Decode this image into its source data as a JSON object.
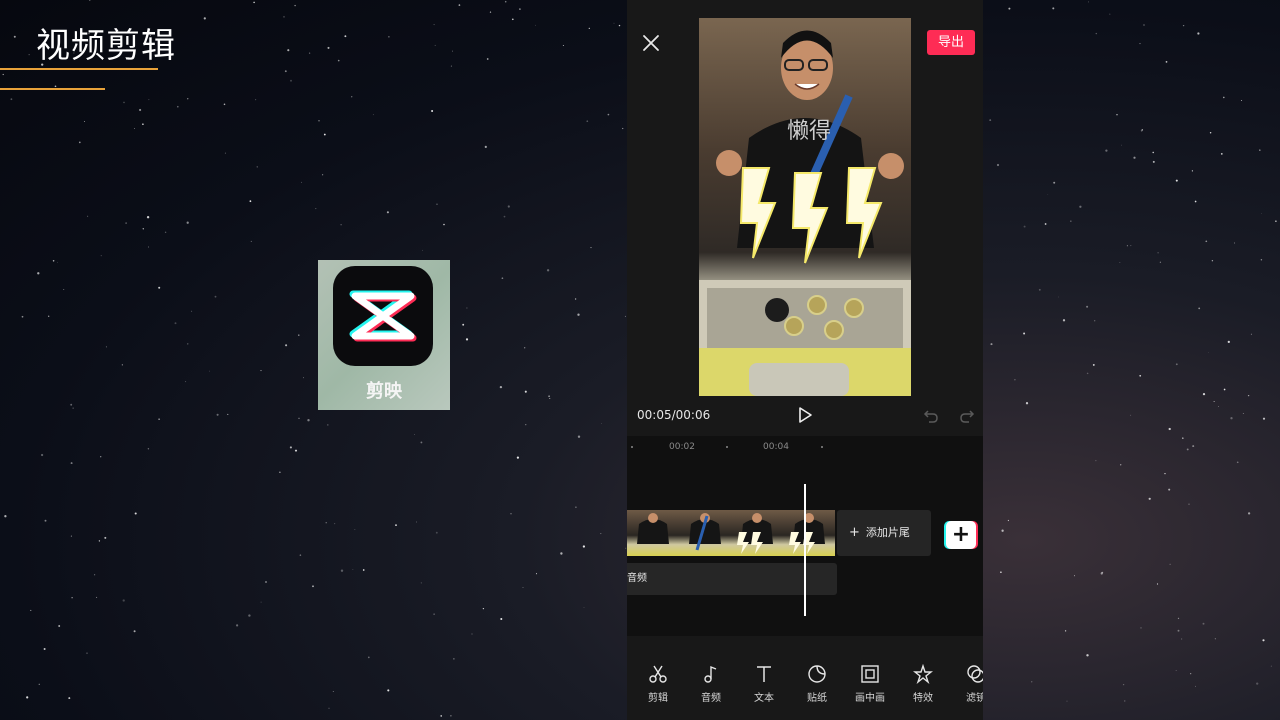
{
  "slide": {
    "title": "视频剪辑"
  },
  "app_icon": {
    "label": "剪映",
    "icon": "capcut-logo-icon"
  },
  "editor": {
    "export_label": "导出",
    "time": {
      "current": "00:05",
      "separator": "/",
      "total": "00:06"
    },
    "ruler": [
      "00:02",
      "00:04"
    ],
    "add_ending_label": "添加片尾",
    "add_clip_label": "+",
    "audio_track_label": "音频",
    "toolbar": [
      {
        "label": "剪辑",
        "icon": "scissors-icon"
      },
      {
        "label": "音频",
        "icon": "music-note-icon"
      },
      {
        "label": "文本",
        "icon": "text-icon"
      },
      {
        "label": "贴纸",
        "icon": "sticker-icon"
      },
      {
        "label": "画中画",
        "icon": "picture-in-picture-icon"
      },
      {
        "label": "特效",
        "icon": "effects-star-icon"
      },
      {
        "label": "滤镜",
        "icon": "filter-icon"
      }
    ]
  },
  "colors": {
    "accent_red": "#fe2c55",
    "accent_cyan": "#25f4ee",
    "title_underline": "#e8a23a",
    "editor_bg": "#181818"
  }
}
